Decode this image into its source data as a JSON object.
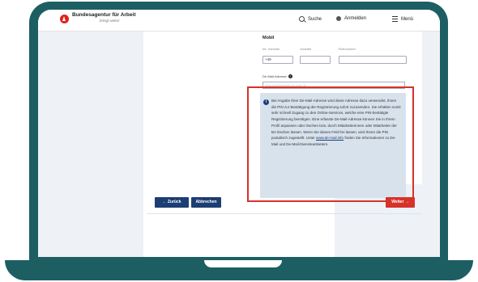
{
  "header": {
    "brand_title": "Bundesagentur für Arbeit",
    "brand_subtitle": "bringt weiter",
    "search_label": "Suche",
    "login_label": "Anmelden",
    "menu_label": "Menü"
  },
  "form": {
    "section_title": "Mobil",
    "fields": [
      {
        "label": "Int. Vorwahl",
        "value": "+49"
      },
      {
        "label": "Vorwahl",
        "value": ""
      },
      {
        "label": "Rufnummer",
        "value": ""
      }
    ],
    "demail_label": "De-Mail-Adresse",
    "demail_placeholder": "beispiel@beispiel.de-mail.de",
    "info_text": "Bei Angabe Ihrer De-Mail-Adresse wird diese Adresse dazu verwendet, Ihnen die PIN zur Bestätigung der Registrierung sofort zuzusenden. Sie erhalten somit sehr schnell Zugang zu den Online-Services, welche eine PIN-bestätigte Registrierung benötigen. Eine erfasste De-Mail-Adresse können Sie in Ihrem Profil anpassen oder löschen bzw. durch Mitarbeiterinnen oder Mitarbeiter der BA löschen lassen. Wenn Sie dieses Feld frei lassen, wird Ihnen die PIN postalisch zugestellt. Unter",
    "info_link": "www.de-mail.info",
    "info_text_end": "finden Sie Informationen zu De-Mail und De-Mail-Diensteanbietern."
  },
  "buttons": {
    "back": "← Zurück",
    "cancel": "Abbrechen",
    "next": "Weiter →"
  },
  "colors": {
    "frame": "#1d5e63",
    "primary": "#1c3e73",
    "accent": "#d7322a"
  }
}
